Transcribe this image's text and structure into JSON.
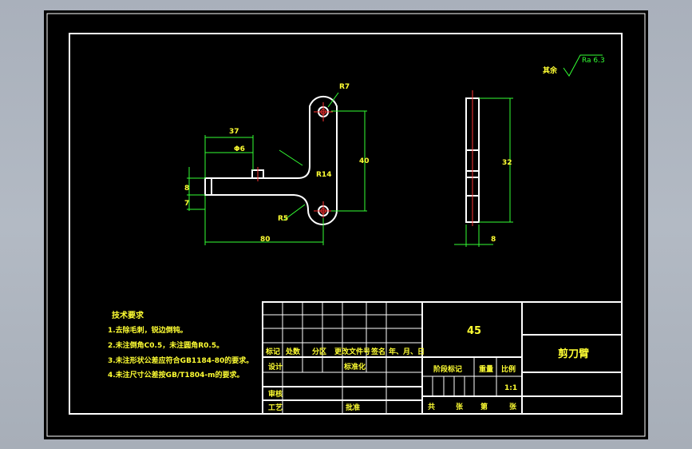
{
  "roughness": {
    "prefix": "其余",
    "symbol": "Ra 6.3"
  },
  "dims": {
    "top_hole": "R7",
    "d37": "37",
    "phi6": "Φ6",
    "r14": "R14",
    "h40": "40",
    "r5": "R5",
    "d80": "80",
    "h8": "8",
    "h7": "7",
    "side_height": "32",
    "side_thickness": "8"
  },
  "tech": {
    "title": "技术要求",
    "items": [
      "1.去除毛刺，锐边倒钝。",
      "2.未注倒角C0.5，未注圆角R0.5。",
      "3.未注形状公差应符合GB1184-80的要求。",
      "4.未注尺寸公差按GB/T1804-m的要求。"
    ]
  },
  "titleblock": {
    "material": "45",
    "part_name": "剪刀臂",
    "headers": [
      "标记",
      "处数",
      "分区",
      "更改文件号",
      "签名",
      "年、月、日"
    ],
    "design": "设计",
    "standardize": "标准化",
    "review": "审核",
    "process": "工艺",
    "approve": "批准",
    "stage_mark": "阶段标记",
    "weight": "重量",
    "scale": "比例",
    "scale_value": "1:1",
    "total": "共",
    "sheets": "张",
    "sheet_no": "第",
    "sheets2": "张"
  }
}
